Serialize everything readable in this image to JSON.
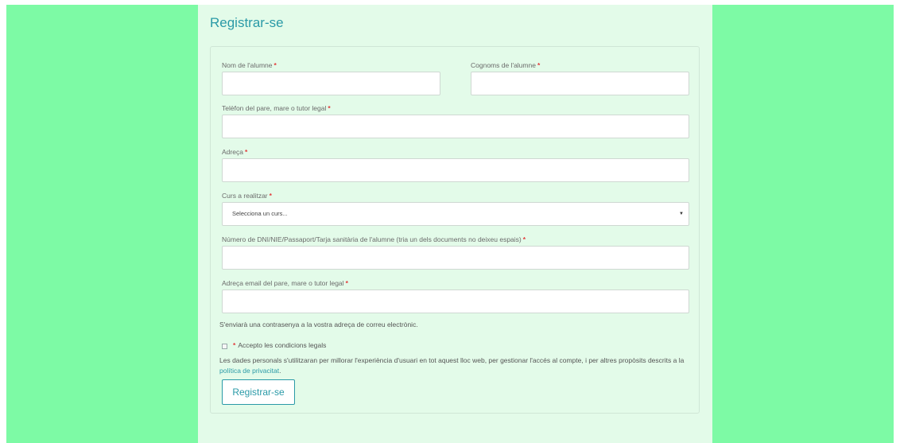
{
  "page": {
    "title": "Registrar-se"
  },
  "form": {
    "first_name_label": "Nom de l'alumne",
    "last_name_label": "Cognoms de l'alumne",
    "phone_label": "Telèfon del pare, mare o tutor legal",
    "address_label": "Adreça",
    "course_label": "Curs a realitzar",
    "course_selected": "Selecciona un curs...",
    "document_label": "Número de DNI/NIE/Passaport/Tarja sanitària de l'alumne (tria un dels documents no deixeu espais)",
    "email_label": "Adreça email del pare, mare o tutor legal",
    "required_mark": "*",
    "password_note": "S'enviarà una contrasenya a la vostra adreça de correu electrònic.",
    "terms_label": "Accepto les condicions legals",
    "privacy_text": "Les dades personals s'utilitzaran per millorar l'experiència d'usuari en tot aquest lloc web, per gestionar l'accés al compte, i per altres propòsits descrits a la",
    "privacy_link": "política de privacitat",
    "privacy_end": ".",
    "submit_label": "Registrar-se"
  },
  "colors": {
    "accent": "#2a9aa7",
    "side_background": "#7dfaa5",
    "content_background": "#e3fbe9",
    "required": "#e23b3b"
  }
}
